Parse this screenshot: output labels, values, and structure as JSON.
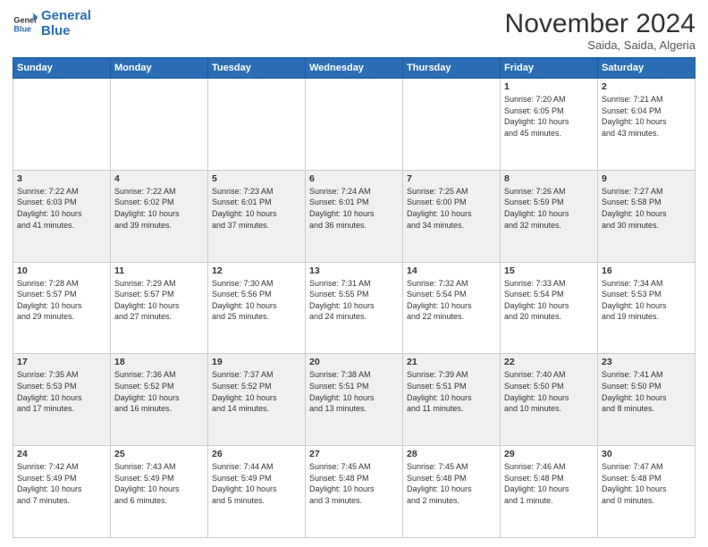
{
  "logo": {
    "line1": "General",
    "line2": "Blue"
  },
  "header": {
    "month": "November 2024",
    "location": "Saida, Saida, Algeria"
  },
  "weekdays": [
    "Sunday",
    "Monday",
    "Tuesday",
    "Wednesday",
    "Thursday",
    "Friday",
    "Saturday"
  ],
  "weeks": [
    [
      {
        "day": "",
        "info": ""
      },
      {
        "day": "",
        "info": ""
      },
      {
        "day": "",
        "info": ""
      },
      {
        "day": "",
        "info": ""
      },
      {
        "day": "",
        "info": ""
      },
      {
        "day": "1",
        "info": "Sunrise: 7:20 AM\nSunset: 6:05 PM\nDaylight: 10 hours\nand 45 minutes."
      },
      {
        "day": "2",
        "info": "Sunrise: 7:21 AM\nSunset: 6:04 PM\nDaylight: 10 hours\nand 43 minutes."
      }
    ],
    [
      {
        "day": "3",
        "info": "Sunrise: 7:22 AM\nSunset: 6:03 PM\nDaylight: 10 hours\nand 41 minutes."
      },
      {
        "day": "4",
        "info": "Sunrise: 7:22 AM\nSunset: 6:02 PM\nDaylight: 10 hours\nand 39 minutes."
      },
      {
        "day": "5",
        "info": "Sunrise: 7:23 AM\nSunset: 6:01 PM\nDaylight: 10 hours\nand 37 minutes."
      },
      {
        "day": "6",
        "info": "Sunrise: 7:24 AM\nSunset: 6:01 PM\nDaylight: 10 hours\nand 36 minutes."
      },
      {
        "day": "7",
        "info": "Sunrise: 7:25 AM\nSunset: 6:00 PM\nDaylight: 10 hours\nand 34 minutes."
      },
      {
        "day": "8",
        "info": "Sunrise: 7:26 AM\nSunset: 5:59 PM\nDaylight: 10 hours\nand 32 minutes."
      },
      {
        "day": "9",
        "info": "Sunrise: 7:27 AM\nSunset: 5:58 PM\nDaylight: 10 hours\nand 30 minutes."
      }
    ],
    [
      {
        "day": "10",
        "info": "Sunrise: 7:28 AM\nSunset: 5:57 PM\nDaylight: 10 hours\nand 29 minutes."
      },
      {
        "day": "11",
        "info": "Sunrise: 7:29 AM\nSunset: 5:57 PM\nDaylight: 10 hours\nand 27 minutes."
      },
      {
        "day": "12",
        "info": "Sunrise: 7:30 AM\nSunset: 5:56 PM\nDaylight: 10 hours\nand 25 minutes."
      },
      {
        "day": "13",
        "info": "Sunrise: 7:31 AM\nSunset: 5:55 PM\nDaylight: 10 hours\nand 24 minutes."
      },
      {
        "day": "14",
        "info": "Sunrise: 7:32 AM\nSunset: 5:54 PM\nDaylight: 10 hours\nand 22 minutes."
      },
      {
        "day": "15",
        "info": "Sunrise: 7:33 AM\nSunset: 5:54 PM\nDaylight: 10 hours\nand 20 minutes."
      },
      {
        "day": "16",
        "info": "Sunrise: 7:34 AM\nSunset: 5:53 PM\nDaylight: 10 hours\nand 19 minutes."
      }
    ],
    [
      {
        "day": "17",
        "info": "Sunrise: 7:35 AM\nSunset: 5:53 PM\nDaylight: 10 hours\nand 17 minutes."
      },
      {
        "day": "18",
        "info": "Sunrise: 7:36 AM\nSunset: 5:52 PM\nDaylight: 10 hours\nand 16 minutes."
      },
      {
        "day": "19",
        "info": "Sunrise: 7:37 AM\nSunset: 5:52 PM\nDaylight: 10 hours\nand 14 minutes."
      },
      {
        "day": "20",
        "info": "Sunrise: 7:38 AM\nSunset: 5:51 PM\nDaylight: 10 hours\nand 13 minutes."
      },
      {
        "day": "21",
        "info": "Sunrise: 7:39 AM\nSunset: 5:51 PM\nDaylight: 10 hours\nand 11 minutes."
      },
      {
        "day": "22",
        "info": "Sunrise: 7:40 AM\nSunset: 5:50 PM\nDaylight: 10 hours\nand 10 minutes."
      },
      {
        "day": "23",
        "info": "Sunrise: 7:41 AM\nSunset: 5:50 PM\nDaylight: 10 hours\nand 8 minutes."
      }
    ],
    [
      {
        "day": "24",
        "info": "Sunrise: 7:42 AM\nSunset: 5:49 PM\nDaylight: 10 hours\nand 7 minutes."
      },
      {
        "day": "25",
        "info": "Sunrise: 7:43 AM\nSunset: 5:49 PM\nDaylight: 10 hours\nand 6 minutes."
      },
      {
        "day": "26",
        "info": "Sunrise: 7:44 AM\nSunset: 5:49 PM\nDaylight: 10 hours\nand 5 minutes."
      },
      {
        "day": "27",
        "info": "Sunrise: 7:45 AM\nSunset: 5:48 PM\nDaylight: 10 hours\nand 3 minutes."
      },
      {
        "day": "28",
        "info": "Sunrise: 7:45 AM\nSunset: 5:48 PM\nDaylight: 10 hours\nand 2 minutes."
      },
      {
        "day": "29",
        "info": "Sunrise: 7:46 AM\nSunset: 5:48 PM\nDaylight: 10 hours\nand 1 minute."
      },
      {
        "day": "30",
        "info": "Sunrise: 7:47 AM\nSunset: 5:48 PM\nDaylight: 10 hours\nand 0 minutes."
      }
    ]
  ]
}
